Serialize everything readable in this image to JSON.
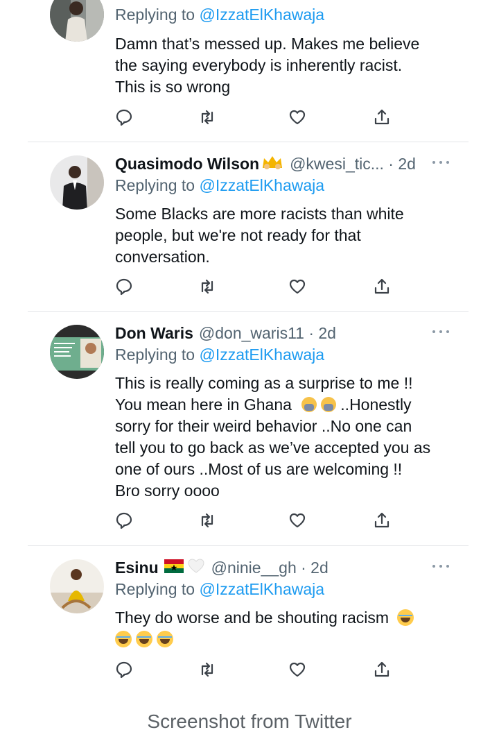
{
  "tweets": [
    {
      "name": "",
      "handle": "",
      "reply_prefix": "Replying to",
      "reply_to": "@IzzatElKhawaja",
      "lines": [
        "Damn that’s messed up. Makes me believe",
        "the saying everybody is inherently racist.",
        "This is so wrong"
      ]
    },
    {
      "name": "Quasimodo Wilson",
      "name_emoji": "crown-hands",
      "handle": "@kwesi_tic... · 2d",
      "reply_prefix": "Replying to",
      "reply_to": "@IzzatElKhawaja",
      "lines": [
        "Some Blacks are more racists than white",
        "people, but we're not ready for that",
        "conversation."
      ]
    },
    {
      "name": "Don Waris",
      "handle": "@don_waris11 · 2d",
      "reply_prefix": "Replying to",
      "reply_to": "@IzzatElKhawaja",
      "lines": [
        "This is really coming as a surprise to me !!",
        "You mean here in Ghana",
        "..Honestly",
        "sorry for their weird behavior ..No one can",
        "tell you to go back as we’ve accepted you as",
        "one of ours ..Most of us are welcoming !!",
        "Bro sorry oooo"
      ]
    },
    {
      "name": "Esinu",
      "name_emoji": "ghana-flag, white-heart",
      "handle": "@ninie__gh · 2d",
      "reply_prefix": "Replying to",
      "reply_to": "@IzzatElKhawaja",
      "lines": [
        "They do worse and be shouting racism"
      ]
    }
  ],
  "icons": {
    "reply": "reply-icon",
    "retweet": "retweet-icon",
    "like": "like-icon",
    "share": "share-icon",
    "more": "more-icon"
  },
  "colors": {
    "text": "#0f1419",
    "muted": "#536471",
    "link": "#1d9bf0",
    "divider": "#e3e5e8"
  },
  "caption": "Screenshot from Twitter"
}
